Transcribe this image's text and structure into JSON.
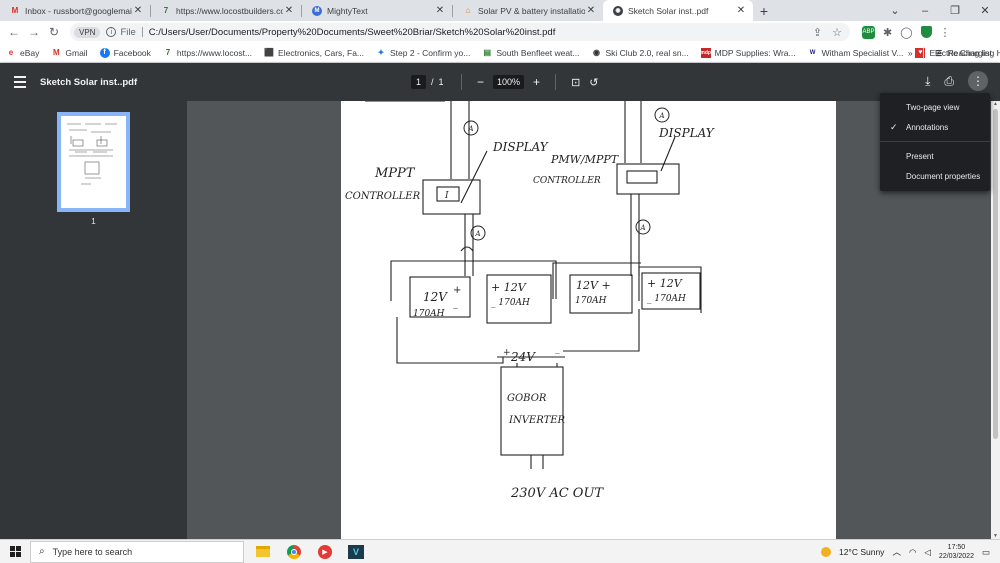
{
  "tabs": [
    {
      "title": "Inbox - russbort@googlemail.co",
      "icon": "gmail-icon",
      "active": false
    },
    {
      "title": "https://www.locostbuilders.co.uk",
      "icon": "locost-icon",
      "active": false
    },
    {
      "title": "MightyText",
      "icon": "mightytext-icon",
      "active": false
    },
    {
      "title": "Solar PV & battery installation on",
      "icon": "solar-site-icon",
      "active": false
    },
    {
      "title": "Sketch Solar inst..pdf",
      "icon": "pdf-tab-icon",
      "active": true
    }
  ],
  "address_bar": {
    "vpn_label": "VPN",
    "scheme_label": "File",
    "url": "C:/Users/User/Documents/Property%20Documents/Sweet%20Briar/Sketch%20Solar%20inst.pdf"
  },
  "extension_badge": "ABP",
  "bookmarks": [
    {
      "label": "eBay",
      "icon": "ebay-icon"
    },
    {
      "label": "Gmail",
      "icon": "gmail-icon"
    },
    {
      "label": "Facebook",
      "icon": "facebook-icon"
    },
    {
      "label": "https://www.locost...",
      "icon": "locost-icon"
    },
    {
      "label": "Electronics, Cars, Fa...",
      "icon": "shopping-icon"
    },
    {
      "label": "Step 2 - Confirm yo...",
      "icon": "globe-icon"
    },
    {
      "label": "South Benfleet weat...",
      "icon": "weather-icon"
    },
    {
      "label": "Ski Club 2.0, real sn...",
      "icon": "ski-icon"
    },
    {
      "label": "MDP Supplies: Wra...",
      "icon": "mdp-icon"
    },
    {
      "label": "Witham Specialist V...",
      "icon": "witham-icon"
    },
    {
      "label": "Electric Charging H...",
      "icon": "charging-icon"
    }
  ],
  "bookmarks_more": "»",
  "reading_list_label": "Reading list",
  "pdf": {
    "title": "Sketch Solar inst..pdf",
    "current_page": "1",
    "page_separator": "/",
    "total_pages": "1",
    "zoom": "100%",
    "thumbnail_label": "1"
  },
  "menu": [
    {
      "label": "Two-page view",
      "checked": false
    },
    {
      "label": "Annotations",
      "checked": true
    },
    {
      "label": "Present",
      "checked": false
    },
    {
      "label": "Document properties",
      "checked": false
    }
  ],
  "sketch": {
    "circle_label": "A",
    "display_left": "DISPLAY",
    "display_right": "DISPLAY",
    "mppt_line1": "MPPT",
    "mppt_line2": "CONTROLLER",
    "pwm_line1": "PMW/MPPT",
    "pwm_line2": "CONTROLLER",
    "controller_box_label": "I",
    "bat1_volt": "12V",
    "bat1_cap": "170AH",
    "bat2_volt": "+ 12V",
    "bat2_cap": "_ 170AH",
    "bat3_volt": "12V +",
    "bat3_cap": "170AH",
    "bat4_volt": "+ 12V",
    "bat4_cap": "_ 170AH",
    "bus_label": "24V",
    "plus": "+",
    "minus": "_",
    "inverter_line1": "GOBOR",
    "inverter_line2": "INVERTER",
    "ac_out": "230V AC OUT"
  },
  "taskbar": {
    "search_placeholder": "Type here to search",
    "weather": "12°C  Sunny",
    "time": "17:50",
    "date": "22/03/2022"
  }
}
